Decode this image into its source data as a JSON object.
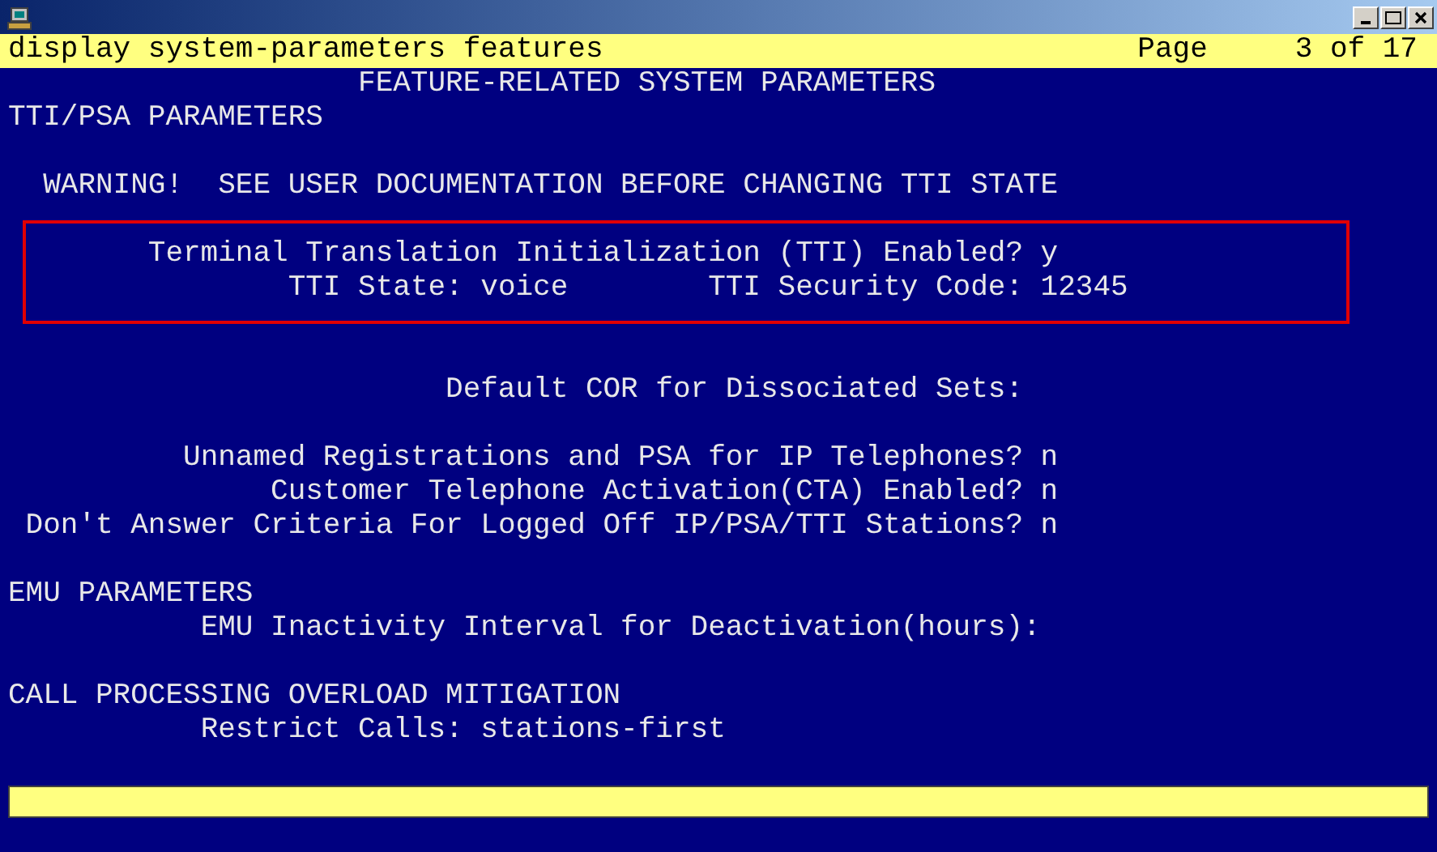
{
  "header": {
    "command": "display system-parameters features",
    "page_label": "Page",
    "page": "3 of 17"
  },
  "lines": [
    {
      "highlighted": false,
      "items": [
        {
          "label": "FEATURE-RELATED SYSTEM PARAMETERS"
        }
      ]
    },
    {
      "highlighted": false,
      "items": [
        {
          "label": "TTI/PSA PARAMETERS"
        }
      ]
    },
    {
      "highlighted": false,
      "items": [
        {
          "label": "WARNING!  SEE USER DOCUMENTATION BEFORE CHANGING TTI STATE"
        }
      ]
    },
    {
      "highlighted": true,
      "items": [
        {
          "label": "Terminal Translation Initialization (TTI) Enabled?",
          "value": "y"
        }
      ]
    },
    {
      "highlighted": true,
      "items": [
        {
          "label": "TTI State:",
          "value": "voice"
        },
        {
          "label": "TTI Security Code:",
          "value": "12345"
        }
      ]
    },
    {
      "highlighted": false,
      "items": [
        {
          "label": "Default COR for Dissociated Sets:"
        }
      ]
    },
    {
      "highlighted": false,
      "items": [
        {
          "label": "Unnamed Registrations and PSA for IP Telephones?",
          "value": "n"
        }
      ]
    },
    {
      "highlighted": false,
      "items": [
        {
          "label": "Customer Telephone Activation(CTA) Enabled?",
          "value": "n"
        }
      ]
    },
    {
      "highlighted": false,
      "items": [
        {
          "label": "Don't Answer Criteria For Logged Off IP/PSA/TTI Stations?",
          "value": "n"
        }
      ]
    },
    {
      "highlighted": false,
      "items": [
        {
          "label": "EMU PARAMETERS"
        }
      ]
    },
    {
      "highlighted": false,
      "items": [
        {
          "label": "EMU Inactivity Interval for Deactivation(hours):"
        }
      ]
    },
    {
      "highlighted": false,
      "items": [
        {
          "label": "CALL PROCESSING OVERLOAD MITIGATION"
        }
      ]
    },
    {
      "highlighted": false,
      "items": [
        {
          "label": "Restrict Calls:",
          "value": "stations-first"
        }
      ]
    }
  ]
}
